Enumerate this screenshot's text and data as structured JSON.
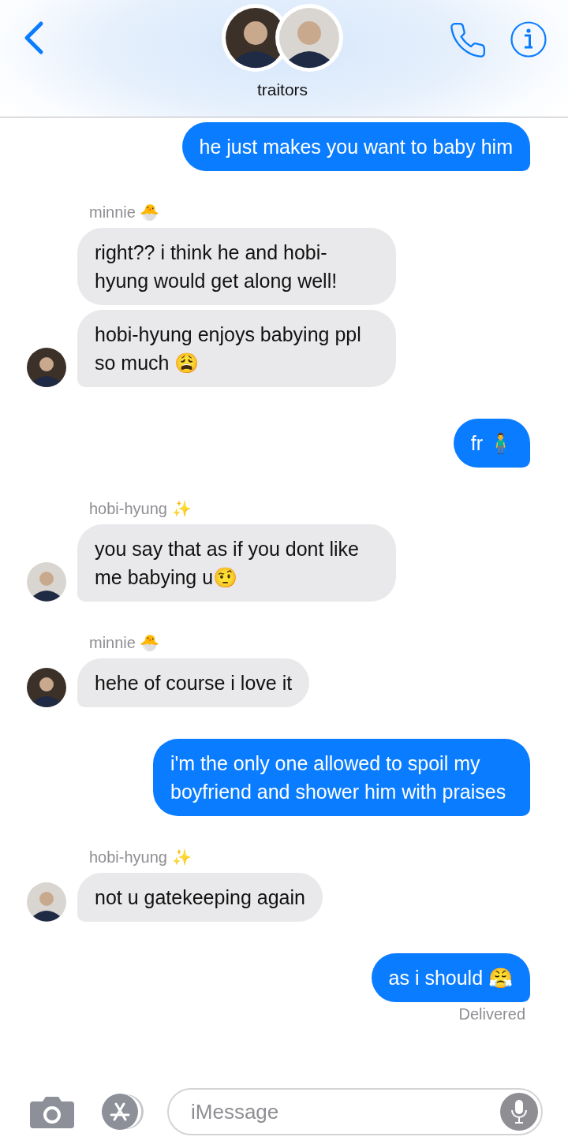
{
  "header": {
    "title": "traitors"
  },
  "groups": [
    {
      "kind": "sent",
      "messages": [
        "he just makes you want to baby him"
      ]
    },
    {
      "kind": "received",
      "sender": "minnie 🐣",
      "messages": [
        "right?? i think he and hobi-hyung would get along well!",
        "hobi-hyung enjoys babying ppl so much 😩"
      ]
    },
    {
      "kind": "sent",
      "messages": [
        "fr 🧍‍♂️"
      ]
    },
    {
      "kind": "received",
      "sender": "hobi-hyung ✨",
      "messages": [
        "you say that as if you dont like me babying u🤨"
      ]
    },
    {
      "kind": "received",
      "sender": "minnie 🐣",
      "messages": [
        "hehe of course i love it"
      ]
    },
    {
      "kind": "sent",
      "messages": [
        "i'm the only one allowed to spoil my boyfriend and shower him with praises"
      ]
    },
    {
      "kind": "received",
      "sender": "hobi-hyung ✨",
      "messages": [
        "not u gatekeeping again"
      ]
    },
    {
      "kind": "sent",
      "messages": [
        "as i should 😤"
      ],
      "status": "Delivered"
    }
  ],
  "composer": {
    "placeholder": "iMessage"
  }
}
